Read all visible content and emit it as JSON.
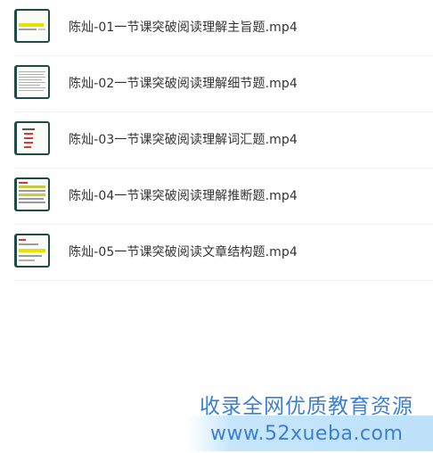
{
  "files": [
    {
      "name": "陈灿-01一节课突破阅读理解主旨题.mp4",
      "thumbnail": "video-thumbnail"
    },
    {
      "name": "陈灿-02一节课突破阅读理解细节题.mp4",
      "thumbnail": "video-thumbnail"
    },
    {
      "name": "陈灿-03一节课突破阅读理解词汇题.mp4",
      "thumbnail": "video-thumbnail"
    },
    {
      "name": "陈灿-04一节课突破阅读理解推断题.mp4",
      "thumbnail": "video-thumbnail"
    },
    {
      "name": "陈灿-05一节课突破阅读文章结构题.mp4",
      "thumbnail": "video-thumbnail"
    }
  ],
  "watermark": {
    "line1": "收录全网优质教育资源",
    "line2": "www.52xueba.com"
  },
  "colors": {
    "thumbnail_frame": "#1f4a46",
    "watermark_text": "#3c7fd0",
    "file_text": "#333333"
  }
}
